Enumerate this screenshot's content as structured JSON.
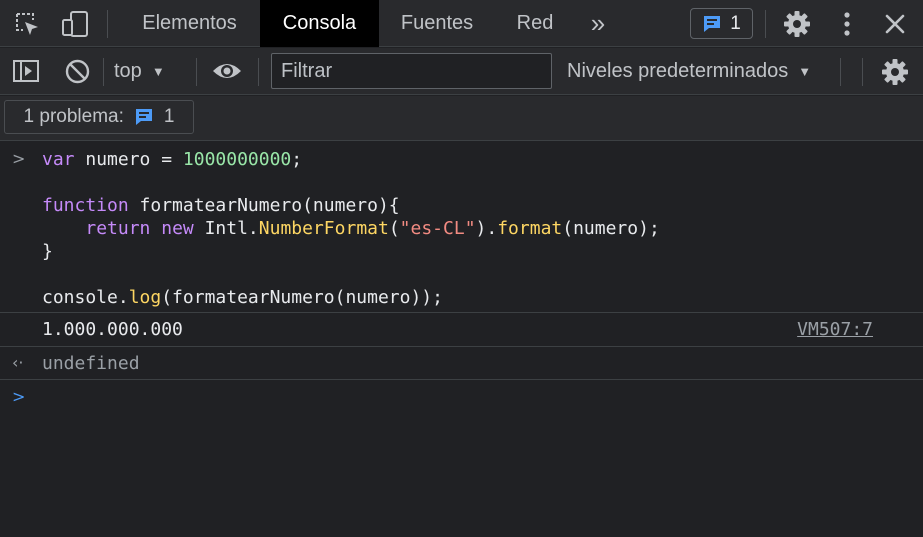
{
  "tabs": {
    "items": [
      "Elementos",
      "Consola",
      "Fuentes",
      "Red"
    ],
    "more": "»",
    "issue_count": "1"
  },
  "toolbar": {
    "context": "top",
    "filter_placeholder": "Filtrar",
    "levels": "Niveles predeterminados"
  },
  "issues": {
    "label": "1 problema:",
    "count": "1"
  },
  "console": {
    "input_lines": {
      "l1_kw": "var",
      "l1_rest": " numero = ",
      "l1_num": "1000000000",
      "l1_end": ";",
      "l2_kw": "function",
      "l2_rest": " formatearNumero(numero){",
      "l3_indent": "    ",
      "l3_kw1": "return",
      "l3_sp1": " ",
      "l3_kw2": "new",
      "l3_a": " Intl.",
      "l3_fn1": "NumberFormat",
      "l3_b": "(",
      "l3_str": "\"es-CL\"",
      "l3_c": ").",
      "l3_fn2": "format",
      "l3_d": "(numero);",
      "l4": "}",
      "l5_a": "console.",
      "l5_fn": "log",
      "l5_b": "(formatearNumero(numero));"
    },
    "log_output": "1.000.000.000",
    "log_source": "VM507:7",
    "return_value": "undefined"
  },
  "colors": {
    "keyword": "#c58af9",
    "number": "#99e6a8",
    "function": "#fdd663",
    "string": "#f28b82",
    "issue_blue": "#4d9bf7"
  }
}
